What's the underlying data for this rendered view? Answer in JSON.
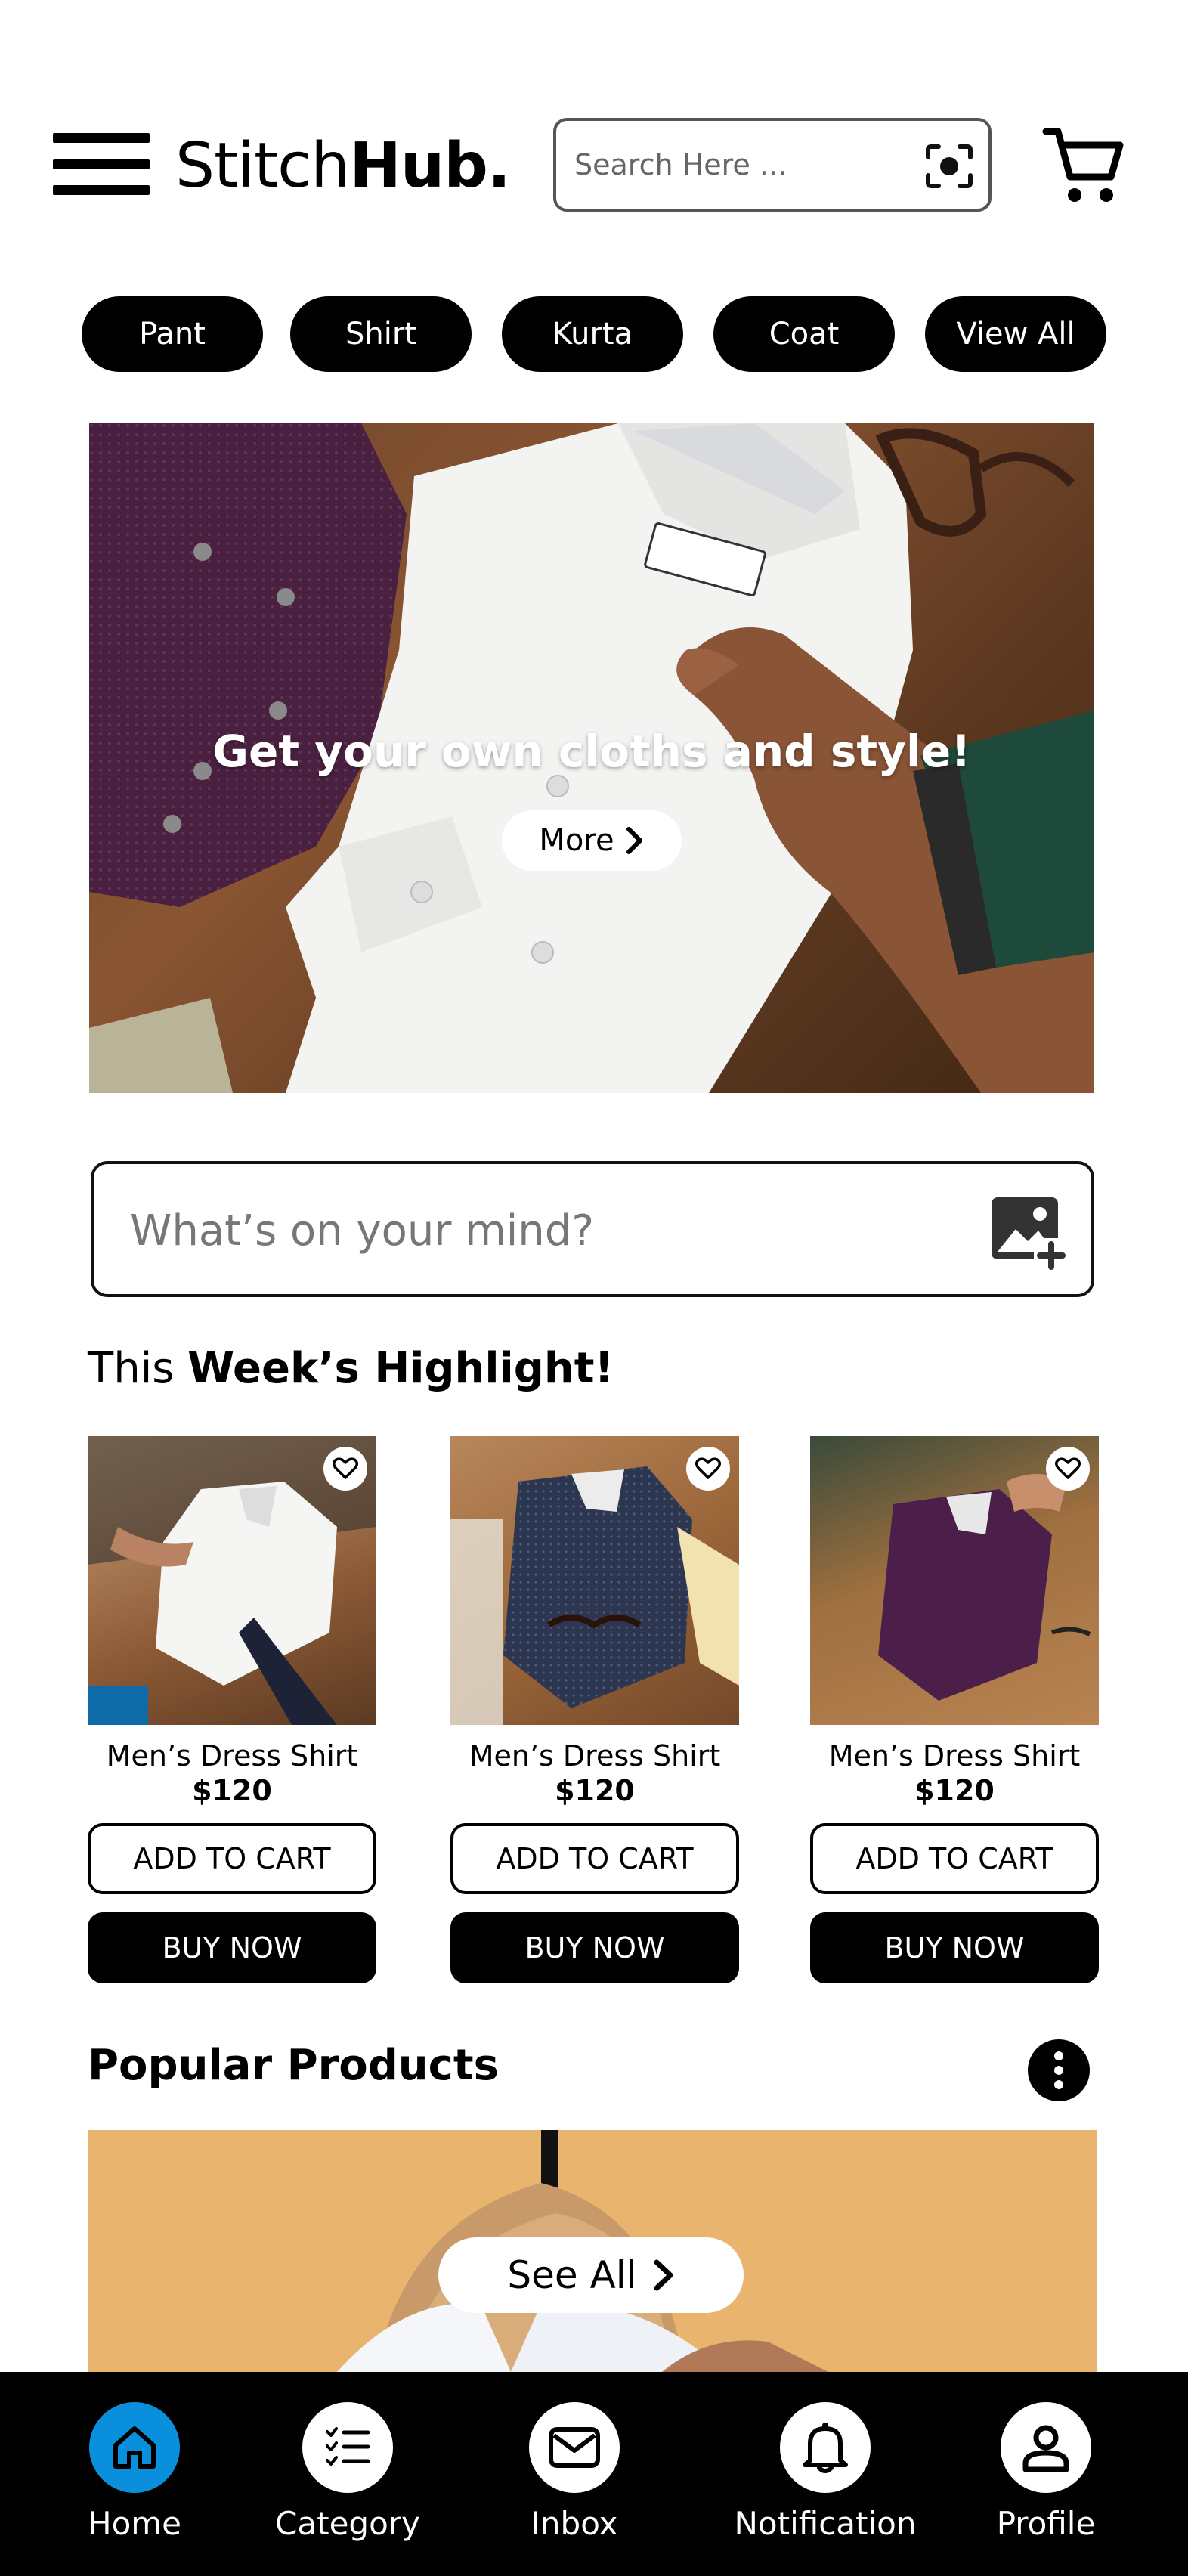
{
  "header": {
    "brand_light": "Stitch",
    "brand_bold": "Hub.",
    "search_placeholder": "Search Here ..."
  },
  "categories": [
    "Pant",
    "Shirt",
    "Kurta",
    "Coat",
    "View All"
  ],
  "hero": {
    "title": "Get your own cloths and style!",
    "button_label": "More"
  },
  "composer": {
    "placeholder": "What’s on your mind?"
  },
  "highlights": {
    "title_light": "This",
    "title_bold": "Week’s Highlight!",
    "products": [
      {
        "name": "Men’s Dress Shirt",
        "price": "$120",
        "add_to_cart": "ADD TO CART",
        "buy_now": "BUY NOW",
        "shirt_color": "#f2f2f0"
      },
      {
        "name": "Men’s Dress Shirt",
        "price": "$120",
        "add_to_cart": "ADD TO CART",
        "buy_now": "BUY NOW",
        "shirt_color": "#2d3650"
      },
      {
        "name": "Men’s Dress Shirt",
        "price": "$120",
        "add_to_cart": "ADD TO CART",
        "buy_now": "BUY NOW",
        "shirt_color": "#4b1f4a"
      }
    ]
  },
  "popular": {
    "title": "Popular Products",
    "see_all_label": "See All"
  },
  "bottom_nav": {
    "items": [
      {
        "label": "Home",
        "icon": "home-icon",
        "active": true
      },
      {
        "label": "Category",
        "icon": "category-list-icon",
        "active": false
      },
      {
        "label": "Inbox",
        "icon": "mail-icon",
        "active": false
      },
      {
        "label": "Notification",
        "icon": "bell-icon",
        "active": false
      },
      {
        "label": "Profile",
        "icon": "profile-icon",
        "active": false
      }
    ]
  },
  "colors": {
    "accent": "#0a8fdc",
    "primary": "#000000",
    "background": "#ffffff"
  }
}
